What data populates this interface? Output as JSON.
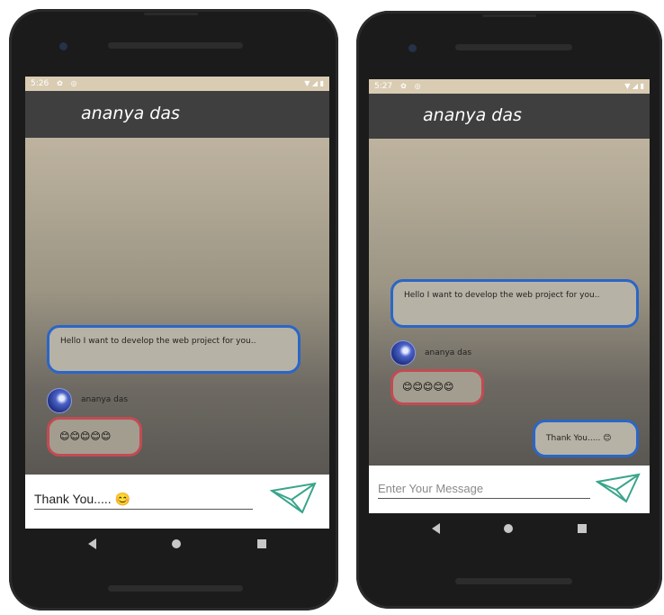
{
  "left_phone": {
    "status_time": "5:26",
    "contact_name": "ananya das",
    "received_message": "Hello I want to develop the web project for you..",
    "sender_name": "ananya das",
    "emoji_message": "😊😊😊😊😊",
    "input_value": "Thank You..... 😊",
    "input_placeholder": "Enter Your Message"
  },
  "right_phone": {
    "status_time": "5:27",
    "contact_name": "ananya das",
    "received_message": "Hello I want to develop the web project for you..",
    "sender_name": "ananya das",
    "emoji_message": "😊😊😊😊😊",
    "sent_message": "Thank You..... 😊",
    "input_value": "",
    "input_placeholder": "Enter Your Message"
  },
  "colors": {
    "appbar": "#3f3f3f",
    "message_border": "#2a66c8",
    "emoji_border": "#c24b52",
    "send_icon": "#3aa58c"
  },
  "icons": [
    "settings-icon",
    "vpn-icon",
    "wifi-icon",
    "signal-icon",
    "battery-icon",
    "send-icon",
    "back-icon",
    "home-icon",
    "recents-icon"
  ]
}
